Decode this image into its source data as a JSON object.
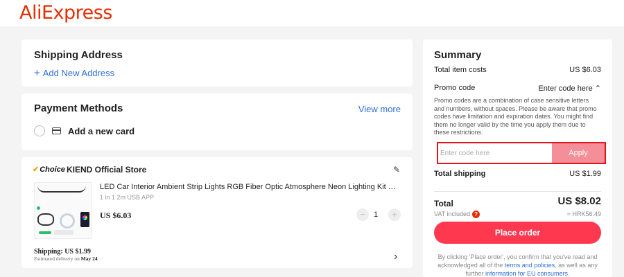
{
  "header": {
    "logo": "AliExpress"
  },
  "shipping_address": {
    "title": "Shipping Address",
    "add_label": "Add New Address"
  },
  "payment": {
    "title": "Payment Methods",
    "view_more": "View more",
    "add_card": "Add a new card"
  },
  "item": {
    "badge": "Choice",
    "store": "KIEND Official Store",
    "title": "LED Car Interior Ambient Strip Lights RGB Fiber Optic Atmosphere Neon Lighting Kit W/ APP Control Auto Decorative Lamp",
    "variant": "1 in 1 2m USB APP",
    "price": "US $6.03",
    "quantity": "1",
    "shipping": "Shipping: US $1.99",
    "delivery_prefix": "Estimated delivery on",
    "delivery_date": "May 24"
  },
  "summary": {
    "title": "Summary",
    "item_costs_label": "Total item costs",
    "item_costs_value": "US $6.03",
    "promo_label": "Promo code",
    "promo_toggle": "Enter code here",
    "promo_desc": "Promo codes are a combination of case sensitive letters and numbers, without spaces. Please be aware that promo codes have limitation and expiration dates. You might find them no longer valid by the time you apply them due to these restrictions.",
    "promo_placeholder": "Enter code here",
    "apply_label": "Apply",
    "shipping_label": "Total shipping",
    "shipping_value": "US $1.99",
    "total_label": "Total",
    "total_value": "US $8.02",
    "vat_label": "VAT included",
    "vat_value": "≈ HRK56.49",
    "place_order": "Place order",
    "legal_1": "By clicking 'Place order', you confirm that you've read and acknowledged all of the",
    "legal_link_1": "terms and policies",
    "legal_2": ", as well as any further",
    "legal_link_2": "information for EU consumers",
    "legal_3": "."
  },
  "colors": {
    "brand": "#e62e04",
    "link": "#2e6ed6",
    "place_order": "#fd384f",
    "apply_disabled": "#f48e98",
    "highlight": "#e0141e"
  }
}
